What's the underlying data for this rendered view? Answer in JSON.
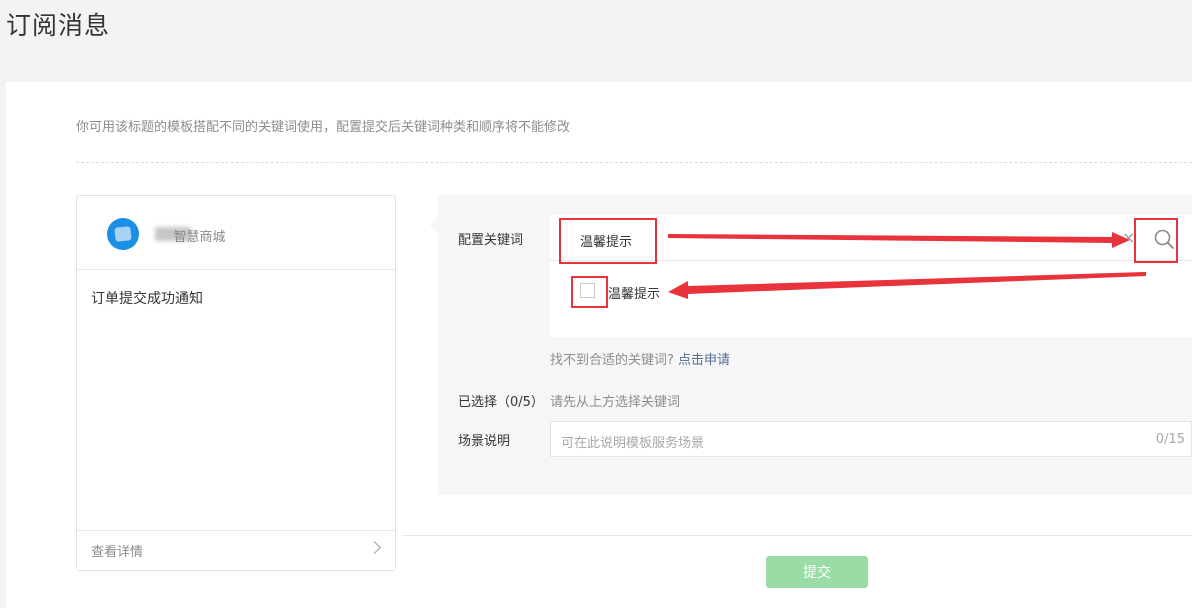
{
  "page": {
    "title": "订阅消息"
  },
  "tip": "你可用该标题的模板搭配不同的关键词使用，配置提交后关键词种类和顺序将不能修改",
  "preview": {
    "shop_name": "智慧商城",
    "template_title": "订单提交成功通知",
    "detail_link": "查看详情"
  },
  "config": {
    "keyword_label": "配置关键词",
    "keyword_value": "温馨提示",
    "clear_icon": "×",
    "option_label": "温馨提示",
    "hint_prefix": "找不到合适的关键词?",
    "hint_link": "点击申请",
    "selected_label": "已选择（0/5）",
    "selected_hint": "请先从上方选择关键词",
    "scene_label": "场景说明",
    "scene_placeholder": "可在此说明模板服务场景",
    "scene_count": "0/15"
  },
  "submit_label": "提交",
  "colors": {
    "accent_green": "#9bdba5",
    "link_blue": "#576b95",
    "annotation_red": "#e8333c",
    "avatar_blue": "#1a8fe3"
  },
  "icons": [
    "search-icon",
    "close-icon",
    "chevron-right-icon",
    "avatar-icon"
  ]
}
